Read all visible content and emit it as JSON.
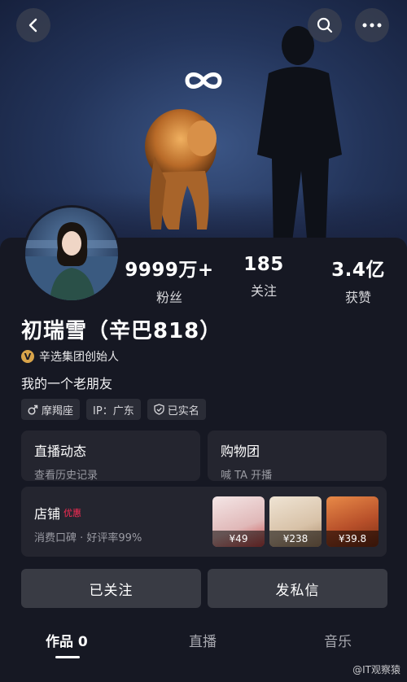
{
  "header": {
    "icons": [
      "back-icon",
      "search-icon",
      "more-icon"
    ],
    "brand_logo": "infinity-logo"
  },
  "profile": {
    "name": "初瑞雪（辛巴818）",
    "verified_badge": "V",
    "verified_title": "辛选集团创始人",
    "bio": "我的一个老朋友",
    "stats": [
      {
        "value": "9999万+",
        "label": "粉丝"
      },
      {
        "value": "185",
        "label": "关注"
      },
      {
        "value": "3.4亿",
        "label": "获赞"
      }
    ],
    "tags": [
      {
        "icon": "male-icon",
        "text": "摩羯座"
      },
      {
        "icon": "",
        "text": "IP：广东"
      },
      {
        "icon": "shield-check-icon",
        "text": "已实名"
      }
    ]
  },
  "cards": {
    "live": {
      "title": "直播动态",
      "subtitle": "查看历史记录"
    },
    "group": {
      "title": "购物团",
      "subtitle": "喊 TA 开播"
    },
    "shop": {
      "title": "店铺",
      "promo": "优惠",
      "subtitle": "消费口碑 · 好评率99%",
      "products": [
        {
          "price": "¥49",
          "color": "#e8d8d8"
        },
        {
          "price": "¥238",
          "color": "#d8c8b8"
        },
        {
          "price": "¥39.8",
          "color": "#b8502a"
        }
      ]
    }
  },
  "actions": {
    "follow": "已关注",
    "message": "发私信"
  },
  "tabs": [
    {
      "label": "作品 0",
      "active": true
    },
    {
      "label": "直播",
      "active": false
    },
    {
      "label": "音乐",
      "active": false
    }
  ],
  "watermark": "@IT观察猿",
  "colors": {
    "background": "#161823",
    "card": "#24252f",
    "button": "#393b44",
    "accent": "#fe2c55",
    "verified": "#d8a44a"
  }
}
